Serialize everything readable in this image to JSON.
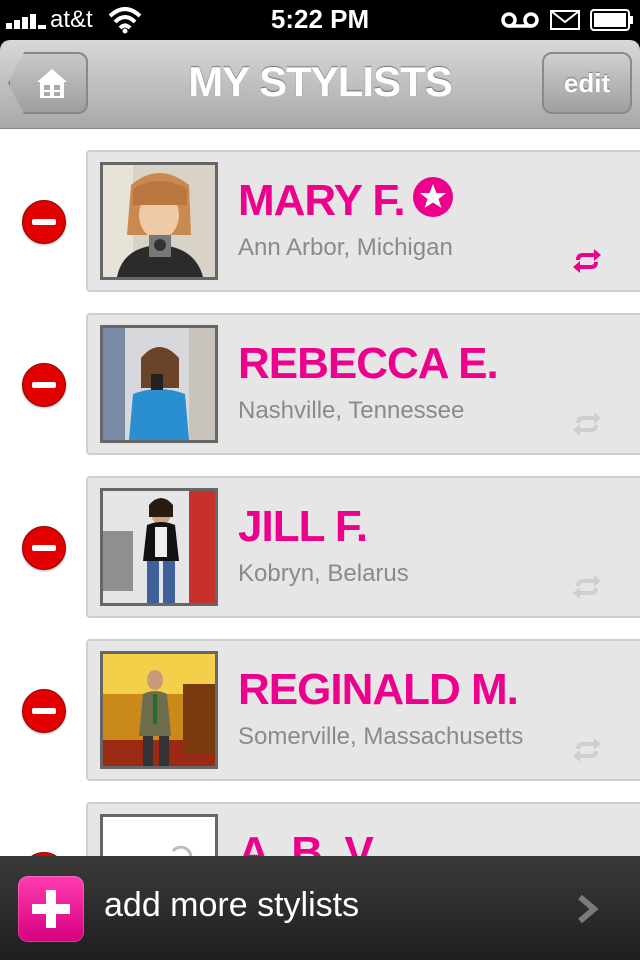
{
  "status_bar": {
    "carrier": "at&t",
    "time": "5:22 PM"
  },
  "nav": {
    "title": "MY STYLISTS",
    "edit_label": "edit",
    "home_icon": "home-icon"
  },
  "stylists": [
    {
      "name": "MARY F.",
      "location": "Ann Arbor, Michigan",
      "featured": true,
      "refresh_color": "#ec008c"
    },
    {
      "name": "REBECCA E.",
      "location": "Nashville, Tennessee",
      "featured": false,
      "refresh_color": "#cfcfcf"
    },
    {
      "name": "JILL F.",
      "location": "Kobryn, Belarus",
      "featured": false,
      "refresh_color": "#cfcfcf"
    },
    {
      "name": "REGINALD M.",
      "location": "Somerville, Massachusetts",
      "featured": false,
      "refresh_color": "#cfcfcf"
    },
    {
      "name": "A. B. V.",
      "location": "",
      "featured": false,
      "refresh_color": "#cfcfcf"
    }
  ],
  "bottom_bar": {
    "label": "add more stylists"
  },
  "colors": {
    "accent": "#ec008c",
    "delete": "#e30000"
  }
}
